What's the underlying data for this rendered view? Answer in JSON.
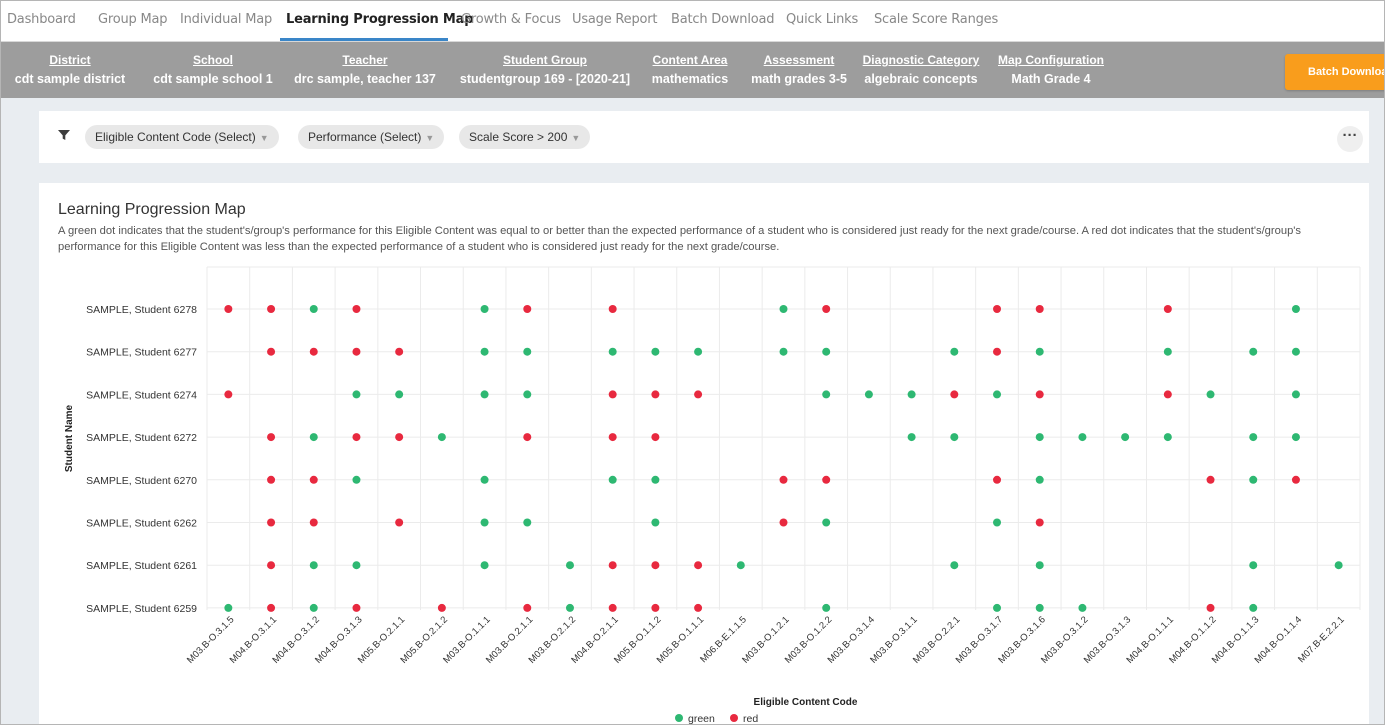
{
  "nav": {
    "tabs": [
      {
        "label": "Dashboard",
        "active": false
      },
      {
        "label": "Group Map",
        "active": false
      },
      {
        "label": "Individual Map",
        "active": false
      },
      {
        "label": "Learning Progression Map",
        "active": true
      },
      {
        "label": "Growth & Focus",
        "active": false
      },
      {
        "label": "Usage Report",
        "active": false
      },
      {
        "label": "Batch Download",
        "active": false
      },
      {
        "label": "Quick Links",
        "active": false
      },
      {
        "label": "Scale Score Ranges",
        "active": false
      }
    ]
  },
  "context": {
    "columns": [
      {
        "header": "District",
        "value": "cdt sample district"
      },
      {
        "header": "School",
        "value": "cdt sample school 1"
      },
      {
        "header": "Teacher",
        "value": "drc sample, teacher 137"
      },
      {
        "header": "Student Group",
        "value": "studentgroup 169 - [2020-21]"
      },
      {
        "header": "Content Area",
        "value": "mathematics"
      },
      {
        "header": "Assessment",
        "value": "math grades 3-5"
      },
      {
        "header": "Diagnostic Category",
        "value": "algebraic concepts"
      },
      {
        "header": "Map Configuration",
        "value": "Math Grade 4"
      }
    ],
    "batch_button": "Batch Download"
  },
  "filters": {
    "icon": "filter-icon",
    "pills": [
      "Eligible Content Code (Select)",
      "Performance (Select)",
      "Scale Score > 200"
    ],
    "more_icon": "more-horizontal-icon"
  },
  "card": {
    "title": "Learning Progression Map",
    "description": "A green dot indicates that the student's/group's performance for this Eligible Content was equal to or better than the expected performance of a student who is considered just ready for the next grade/course. A red dot indicates that the student's/group's performance for this Eligible Content was less than the expected performance of a student who is considered just ready for the next grade/course."
  },
  "colors": {
    "green": "#2eb872",
    "red": "#e8293f",
    "accent": "#3a86c8",
    "button": "#f99d1c",
    "context_bg": "#9d9d9d"
  },
  "chart_data": {
    "type": "scatter",
    "xlabel": "Eligible Content Code",
    "ylabel": "Student Name",
    "x_categories": [
      "M03.B-O.3.1.5",
      "M04.B-O.3.1.1",
      "M04.B-O.3.1.2",
      "M04.B-O.3.1.3",
      "M05.B-O.2.1.1",
      "M05.B-O.2.1.2",
      "M03.B-O.1.1.1",
      "M03.B-O.2.1.1",
      "M03.B-O.2.1.2",
      "M04.B-O.2.1.1",
      "M05.B-O.1.1.2",
      "M05.B-O.1.1.1",
      "M06.B-E.1.1.5",
      "M03.B-O.1.2.1",
      "M03.B-O.1.2.2",
      "M03.B-O.3.1.4",
      "M03.B-O.3.1.1",
      "M03.B-O.2.2.1",
      "M03.B-O.3.1.7",
      "M03.B-O.3.1.6",
      "M03.B-O.3.1.2",
      "M03.B-O.3.1.3",
      "M04.B-O.1.1.1",
      "M04.B-O.1.1.2",
      "M04.B-O.1.1.3",
      "M04.B-O.1.1.4",
      "M07.B-E.2.2.1"
    ],
    "y_categories": [
      "SAMPLE, Student 6278",
      "SAMPLE, Student 6277",
      "SAMPLE, Student 6274",
      "SAMPLE, Student 6272",
      "SAMPLE, Student 6270",
      "SAMPLE, Student 6262",
      "SAMPLE, Student 6261",
      "SAMPLE, Student 6259"
    ],
    "series": [
      {
        "name": "green",
        "color": "#2eb872",
        "points": [
          [
            2,
            0
          ],
          [
            6,
            0
          ],
          [
            13,
            0
          ],
          [
            25,
            0
          ],
          [
            6,
            1
          ],
          [
            7,
            1
          ],
          [
            9,
            1
          ],
          [
            10,
            1
          ],
          [
            11,
            1
          ],
          [
            13,
            1
          ],
          [
            14,
            1
          ],
          [
            17,
            1
          ],
          [
            19,
            1
          ],
          [
            22,
            1
          ],
          [
            24,
            1
          ],
          [
            25,
            1
          ],
          [
            3,
            2
          ],
          [
            4,
            2
          ],
          [
            6,
            2
          ],
          [
            7,
            2
          ],
          [
            14,
            2
          ],
          [
            15,
            2
          ],
          [
            16,
            2
          ],
          [
            18,
            2
          ],
          [
            23,
            2
          ],
          [
            25,
            2
          ],
          [
            2,
            3
          ],
          [
            5,
            3
          ],
          [
            16,
            3
          ],
          [
            17,
            3
          ],
          [
            19,
            3
          ],
          [
            20,
            3
          ],
          [
            21,
            3
          ],
          [
            22,
            3
          ],
          [
            24,
            3
          ],
          [
            25,
            3
          ],
          [
            3,
            4
          ],
          [
            6,
            4
          ],
          [
            9,
            4
          ],
          [
            10,
            4
          ],
          [
            19,
            4
          ],
          [
            24,
            4
          ],
          [
            6,
            5
          ],
          [
            7,
            5
          ],
          [
            10,
            5
          ],
          [
            14,
            5
          ],
          [
            18,
            5
          ],
          [
            2,
            6
          ],
          [
            3,
            6
          ],
          [
            6,
            6
          ],
          [
            8,
            6
          ],
          [
            12,
            6
          ],
          [
            17,
            6
          ],
          [
            19,
            6
          ],
          [
            24,
            6
          ],
          [
            26,
            6
          ],
          [
            0,
            7
          ],
          [
            2,
            7
          ],
          [
            8,
            7
          ],
          [
            14,
            7
          ],
          [
            18,
            7
          ],
          [
            19,
            7
          ],
          [
            20,
            7
          ],
          [
            24,
            7
          ]
        ]
      },
      {
        "name": "red",
        "color": "#e8293f",
        "points": [
          [
            0,
            0
          ],
          [
            1,
            0
          ],
          [
            3,
            0
          ],
          [
            7,
            0
          ],
          [
            9,
            0
          ],
          [
            14,
            0
          ],
          [
            18,
            0
          ],
          [
            19,
            0
          ],
          [
            22,
            0
          ],
          [
            1,
            1
          ],
          [
            2,
            1
          ],
          [
            3,
            1
          ],
          [
            4,
            1
          ],
          [
            18,
            1
          ],
          [
            0,
            2
          ],
          [
            9,
            2
          ],
          [
            10,
            2
          ],
          [
            11,
            2
          ],
          [
            17,
            2
          ],
          [
            19,
            2
          ],
          [
            22,
            2
          ],
          [
            1,
            3
          ],
          [
            3,
            3
          ],
          [
            4,
            3
          ],
          [
            7,
            3
          ],
          [
            9,
            3
          ],
          [
            10,
            3
          ],
          [
            1,
            4
          ],
          [
            2,
            4
          ],
          [
            13,
            4
          ],
          [
            14,
            4
          ],
          [
            18,
            4
          ],
          [
            23,
            4
          ],
          [
            25,
            4
          ],
          [
            1,
            5
          ],
          [
            2,
            5
          ],
          [
            4,
            5
          ],
          [
            13,
            5
          ],
          [
            19,
            5
          ],
          [
            1,
            6
          ],
          [
            9,
            6
          ],
          [
            10,
            6
          ],
          [
            11,
            6
          ],
          [
            1,
            7
          ],
          [
            3,
            7
          ],
          [
            5,
            7
          ],
          [
            7,
            7
          ],
          [
            9,
            7
          ],
          [
            10,
            7
          ],
          [
            11,
            7
          ],
          [
            23,
            7
          ]
        ]
      }
    ],
    "legend": {
      "position": "bottom",
      "entries": [
        "green",
        "red"
      ]
    },
    "grid": true
  }
}
